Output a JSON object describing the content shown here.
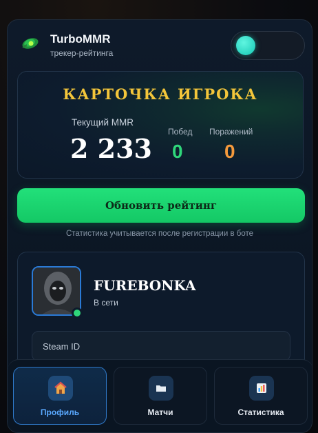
{
  "header": {
    "title": "TurboMMR",
    "subtitle": "трекер-рейтинга",
    "logo_icon": "leaf-logo-icon",
    "theme_toggle": {
      "state": "on",
      "accent": "#22d3bd"
    }
  },
  "player_card": {
    "title": "КАРТОЧКА ИГРОКА",
    "mmr_label": "Текущий MMR",
    "mmr_value": "2 233",
    "wins_label": "Побед",
    "wins_value": "0",
    "losses_label": "Поражений",
    "losses_value": "0",
    "colors": {
      "title": "#f3c53a",
      "wins": "#2fd67a",
      "losses": "#f59a3c"
    }
  },
  "actions": {
    "refresh_label": "Обновить рейтинг",
    "note": "Статистика учитывается после регистрации в боте",
    "refresh_color": "#1ed872"
  },
  "profile": {
    "username": "FUREBONKA",
    "status": "В сети",
    "status_color": "#2fd67a",
    "steam_id_label": "Steam ID"
  },
  "nav": {
    "items": [
      {
        "label": "Профиль",
        "icon": "house-icon",
        "active": true
      },
      {
        "label": "Матчи",
        "icon": "folder-icon",
        "active": false
      },
      {
        "label": "Статистика",
        "icon": "bar-chart-icon",
        "active": false
      }
    ],
    "active_color": "#5aa9ff"
  }
}
